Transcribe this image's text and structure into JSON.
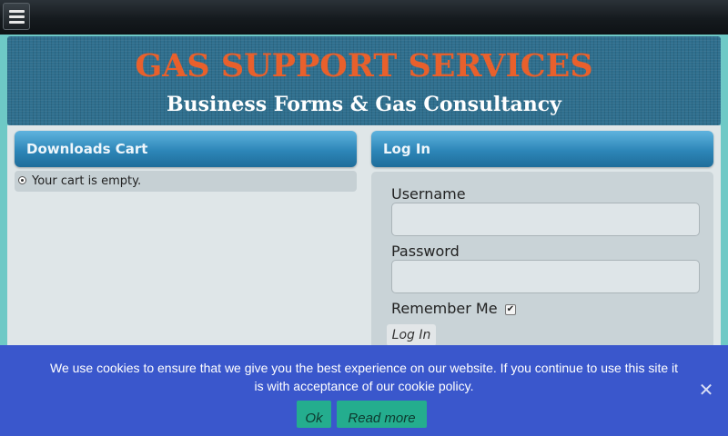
{
  "header": {
    "menu_icon": "hamburger-menu-icon",
    "site_title": "GAS SUPPORT SERVICES",
    "site_subtitle": "Business Forms & Gas Consultancy",
    "title_color": "#e8602c"
  },
  "cart": {
    "heading": "Downloads Cart",
    "empty_message": "Your cart is empty."
  },
  "login": {
    "heading": "Log In",
    "username_label": "Username",
    "username_value": "",
    "password_label": "Password",
    "password_value": "",
    "remember_label": "Remember Me",
    "remember_checked": true,
    "submit_label": "Log In"
  },
  "cookie_banner": {
    "message": "We use cookies to ensure that we give you the best experience on our website. If you continue to use this site it is with acceptance of our cookie policy.",
    "ok_label": "Ok",
    "read_more_label": "Read more",
    "close_icon": "close-icon",
    "background_color": "#3a57cc",
    "button_color": "#24ad8e"
  }
}
